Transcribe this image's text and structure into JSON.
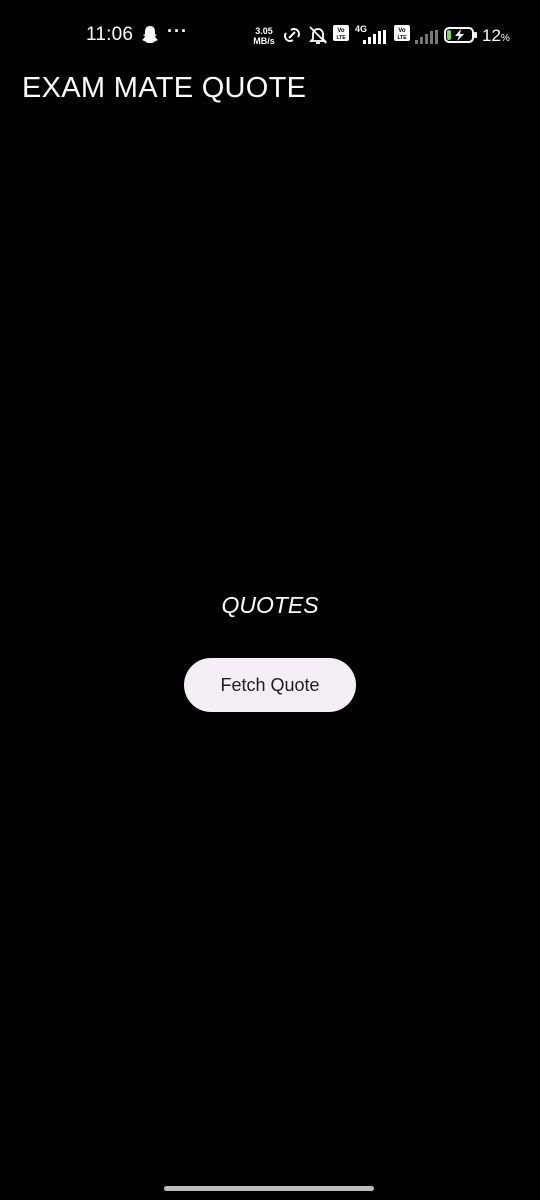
{
  "status_bar": {
    "time": "11:06",
    "dots": "···",
    "speed_value": "3.05",
    "speed_unit": "MB/s",
    "network": "4G",
    "volte_label": "Vo LTE",
    "battery_percent": "12",
    "battery_unit": "%",
    "icons": [
      "snapchat-ghost-icon",
      "hotspot-link-icon",
      "bell-off-icon",
      "volte-icon",
      "signal-icon",
      "battery-charging-icon"
    ]
  },
  "app": {
    "title": "EXAM MATE QUOTE"
  },
  "main": {
    "quote_text": "QUOTES",
    "fetch_button_label": "Fetch Quote"
  },
  "colors": {
    "background": "#000000",
    "text": "#ffffff",
    "button_bg": "#f6eef7",
    "button_text": "#1c1b1f",
    "battery_green": "#7ed957"
  }
}
